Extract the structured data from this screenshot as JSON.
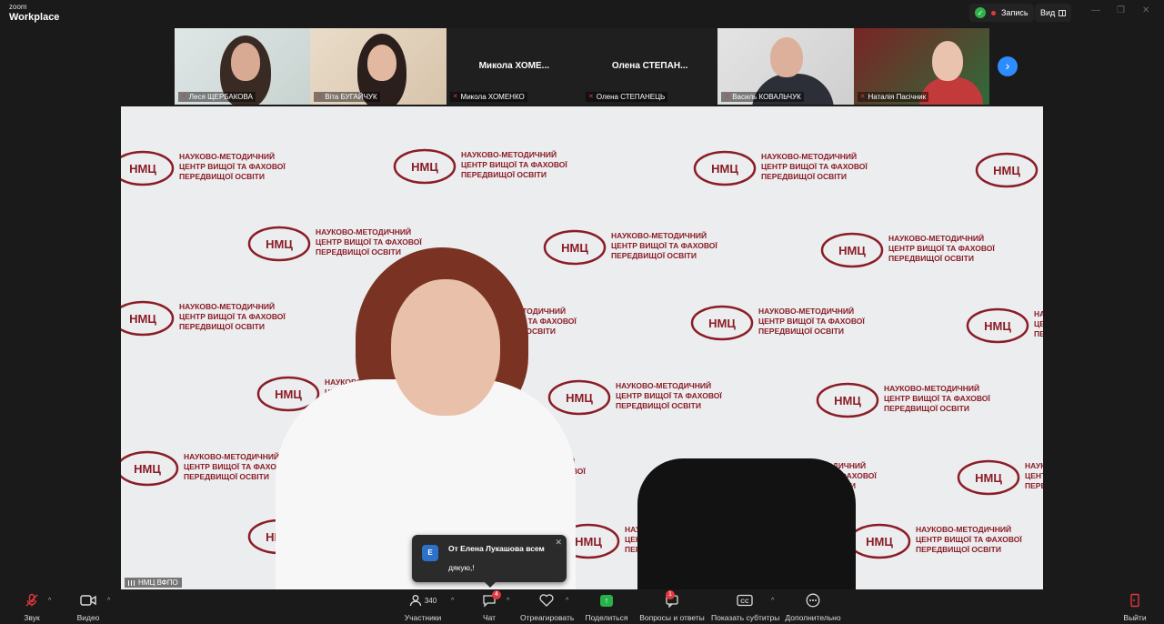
{
  "app": {
    "logo_top": "zoom",
    "logo_bottom": "Workplace"
  },
  "header": {
    "recording_label": "Запись",
    "view_label": "Вид"
  },
  "participants": [
    {
      "name": "Леся ЩЕРБАКОВА",
      "muted": true
    },
    {
      "name": "Віта БУГАЙЧУК",
      "muted": true
    },
    {
      "name": "Микола ХОМЕНКО",
      "muted": true,
      "center_label": "Микола  ХОМЕ..."
    },
    {
      "name": "Олена СТЕПАНЕЦЬ",
      "muted": true,
      "center_label": "Олена  СТЕПАН..."
    },
    {
      "name": "Василь КОВАЛЬЧУК",
      "muted": true
    },
    {
      "name": "Наталія Пасічник",
      "muted": true
    }
  ],
  "stage": {
    "speaker_label": "НМЦ ВФПО",
    "backdrop_logo": "НМЦ",
    "backdrop_text_lines": [
      "НАУКОВО-МЕТОДИЧНИЙ",
      "ЦЕНТР ВИЩОЇ ТА ФАХОВОЇ",
      "ПЕРЕДВИЩОЇ ОСВІТИ"
    ]
  },
  "chat_notice": {
    "avatar_letter": "E",
    "from": "От Елена Лукашова всем",
    "message": "дякую,!"
  },
  "toolbar": {
    "audio": "Звук",
    "video": "Видео",
    "participants": "Участники",
    "participants_count": "340",
    "chat": "Чат",
    "chat_badge": "4",
    "react": "Отреагировать",
    "share": "Поделиться",
    "qa": "Вопросы и ответы",
    "qa_badge": "1",
    "captions": "Показать субтитры",
    "more": "Дополнительно",
    "leave": "Выйти"
  },
  "colors": {
    "accent": "#2d8cff",
    "danger": "#e0393e",
    "share_green": "#25b34a",
    "backdrop_red": "#8a1d26"
  }
}
